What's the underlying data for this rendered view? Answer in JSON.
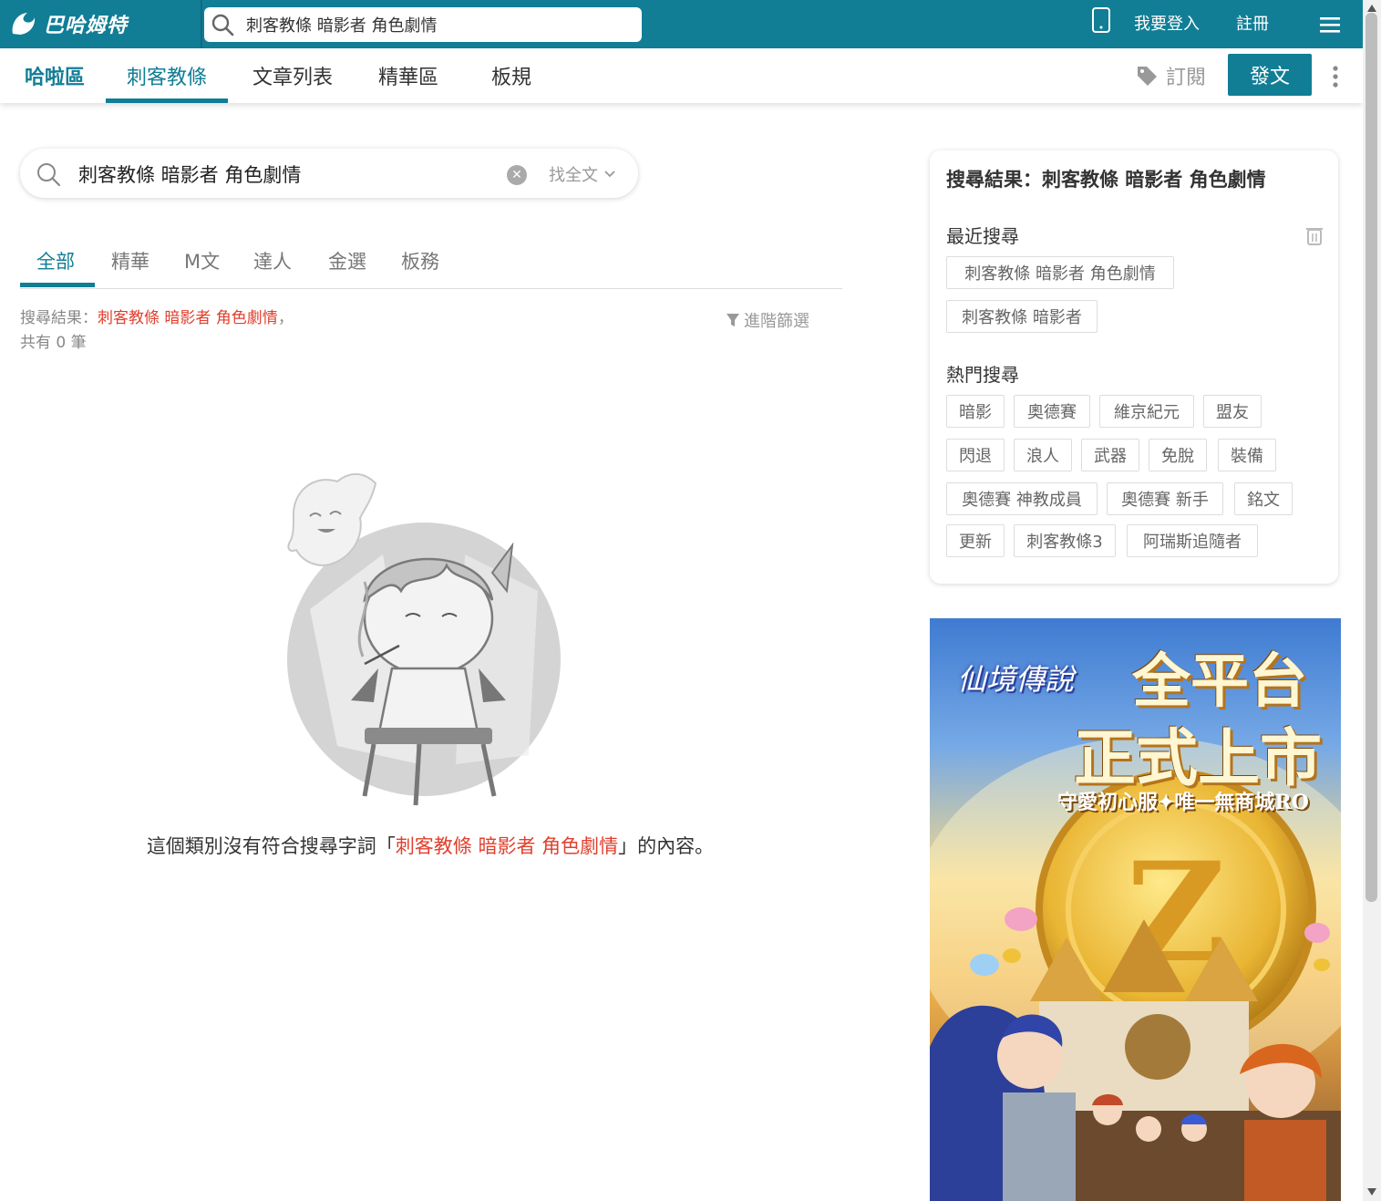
{
  "topbar": {
    "logo_text": "巴哈姆特",
    "search_value": "刺客教條 暗影者 角色劇情",
    "login_label": "我要登入",
    "register_label": "註冊"
  },
  "subnav": {
    "tabs": [
      {
        "label": "哈啦區"
      },
      {
        "label": "刺客教條"
      },
      {
        "label": "文章列表"
      },
      {
        "label": "精華區"
      },
      {
        "label": "板規"
      }
    ],
    "subscribe_label": "訂閱",
    "post_label": "發文"
  },
  "search": {
    "value": "刺客教條 暗影者 角色劇情",
    "scope_label": "找全文"
  },
  "filter_tabs": [
    "全部",
    "精華",
    "M文",
    "達人",
    "金選",
    "板務"
  ],
  "result": {
    "prefix": "搜尋結果：",
    "keyword": "刺客教條 暗影者 角色劇情",
    "suffix": "，",
    "count_text": "共有 0 筆",
    "advanced_filter_label": "進階篩選"
  },
  "empty": {
    "before": "這個類別沒有符合搜尋字詞「",
    "keyword": "刺客教條 暗影者 角色劇情",
    "after": "」的內容。"
  },
  "side": {
    "title": "搜尋結果：刺客教條 暗影者 角色劇情",
    "recent_title": "最近搜尋",
    "recent": [
      "刺客教條 暗影者 角色劇情",
      "刺客教條 暗影者"
    ],
    "hot_title": "熱門搜尋",
    "hot": [
      "暗影",
      "奧德賽",
      "維京紀元",
      "盟友",
      "閃退",
      "浪人",
      "武器",
      "免脫",
      "裝備",
      "奧德賽 神教成員",
      "奧德賽 新手",
      "銘文",
      "更新",
      "刺客教條3",
      "阿瑞斯追隨者"
    ]
  },
  "ad": {
    "game_logo": "仙境傳說",
    "headline_1": "全平台",
    "headline_2": "正式上市",
    "tagline": "守愛初心服✦唯一無商城RO"
  },
  "colors": {
    "brand": "#117e96",
    "keyword": "#e0402e"
  }
}
